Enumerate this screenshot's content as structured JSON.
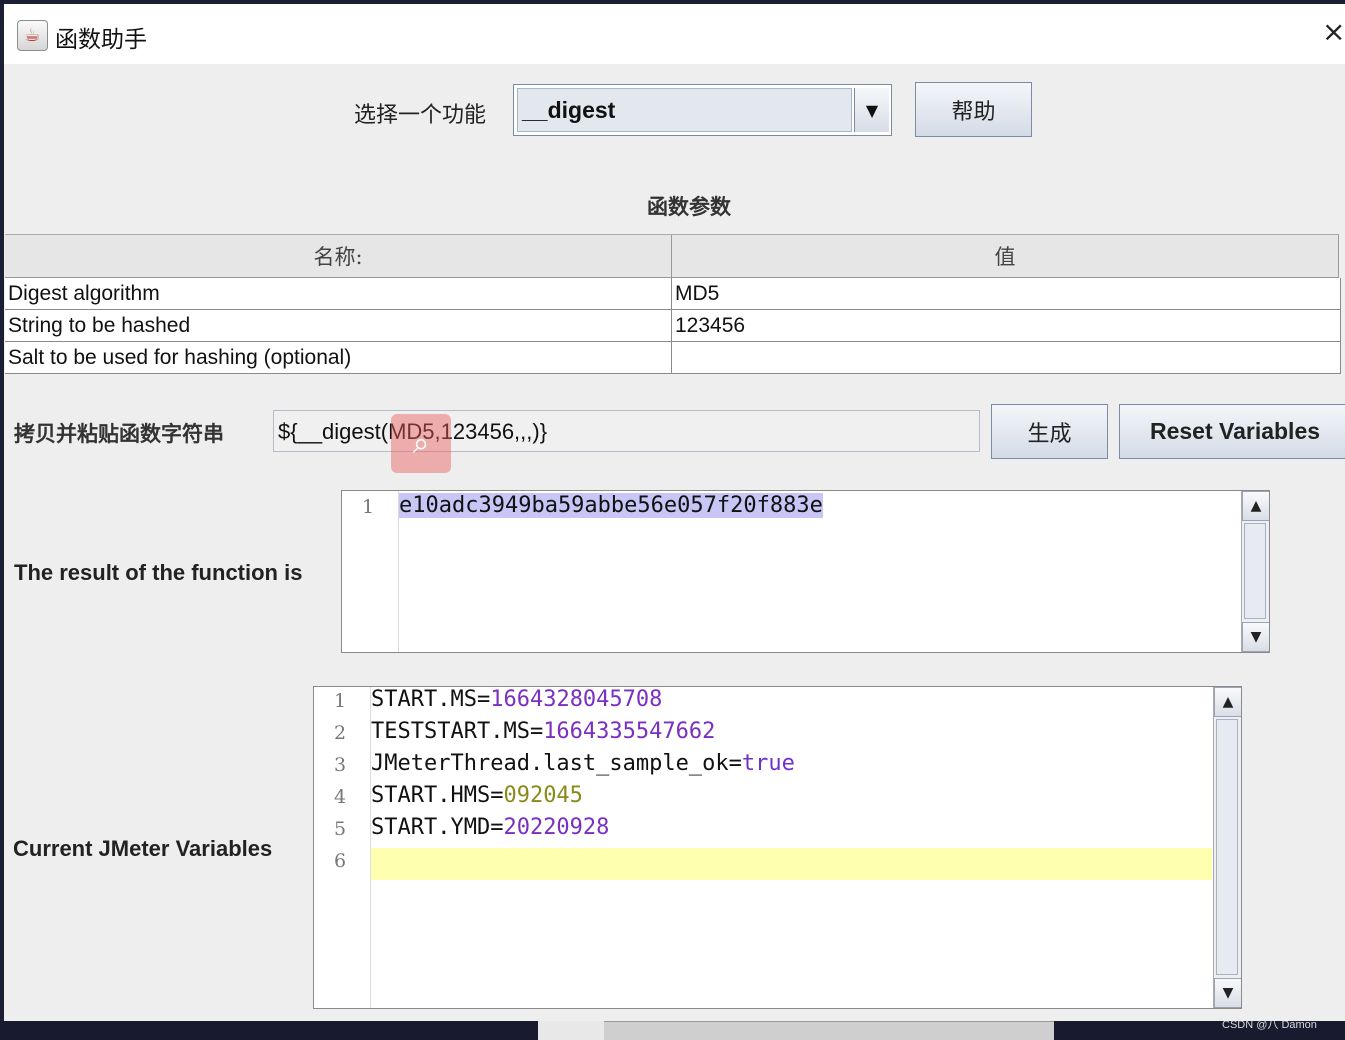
{
  "window": {
    "title": "函数助手",
    "icon": "java-cup-icon",
    "close_glyph": "×"
  },
  "selector": {
    "label": "选择一个功能",
    "value": "__digest",
    "arrow_glyph": "▼",
    "help_label": "帮助"
  },
  "params": {
    "title": "函数参数",
    "columns": [
      "名称:",
      "值"
    ],
    "rows": [
      {
        "name": "Digest algorithm",
        "value": "MD5"
      },
      {
        "name": "String to be hashed",
        "value": "123456"
      },
      {
        "name": "Salt to be used for hashing (optional)",
        "value": ""
      }
    ]
  },
  "copy": {
    "label": "拷贝并粘贴函数字符串",
    "value": "${__digest(MD5,123456,,,)}"
  },
  "buttons": {
    "generate": "生成",
    "reset": "Reset Variables"
  },
  "result": {
    "label": "The result of the function is",
    "lines": [
      {
        "num": "1",
        "text": "e10adc3949ba59abbe56e057f20f883e"
      }
    ]
  },
  "variables": {
    "label": "Current JMeter Variables",
    "lines": [
      {
        "num": "1",
        "key": "START.MS=",
        "value": "1664328045708"
      },
      {
        "num": "2",
        "key": "TESTSTART.MS=",
        "value": "1664335547662"
      },
      {
        "num": "3",
        "key": "JMeterThread.last_sample_ok=",
        "value": "true"
      },
      {
        "num": "4",
        "key": "START.HMS=",
        "value": "092045"
      },
      {
        "num": "5",
        "key": "START.YMD=",
        "value": "20220928"
      },
      {
        "num": "6",
        "key": "",
        "value": ""
      }
    ]
  },
  "footer": {
    "watermark": "CSDN @八 Damon"
  },
  "colors": {
    "selection": "#c8c6f7",
    "current_line": "#ffffb0",
    "number_purple": "#7a2fc0",
    "olive": "#8a8a1a"
  }
}
